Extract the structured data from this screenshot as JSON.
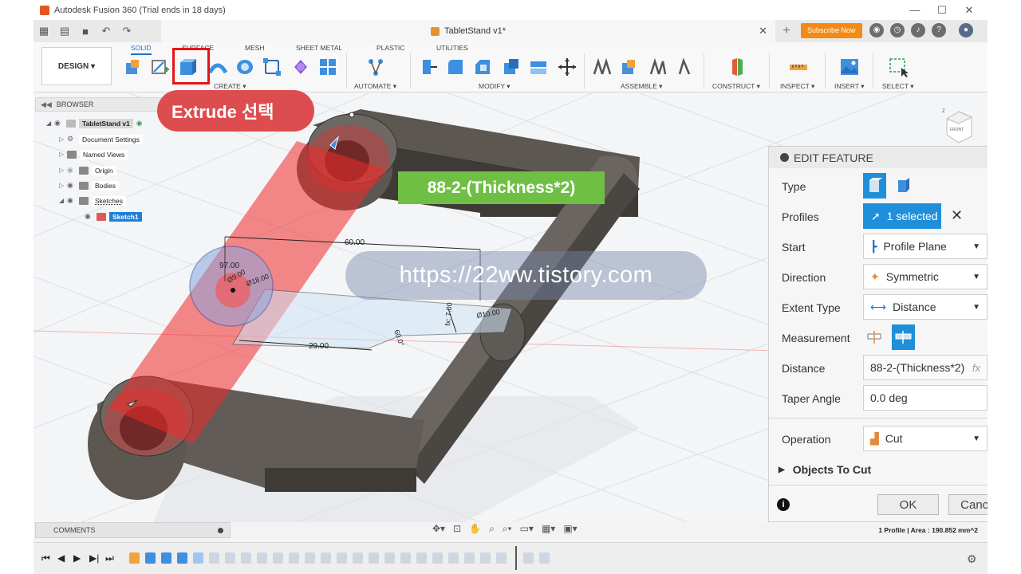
{
  "window": {
    "title": "Autodesk Fusion 360 (Trial ends in 18 days)"
  },
  "document": {
    "tab_title": "TabletStand v1*"
  },
  "header": {
    "subscribe_label": "Subscribe Now"
  },
  "workspace": {
    "label": "DESIGN ▾"
  },
  "ribbon": {
    "tabs": [
      "SOLID",
      "SURFACE",
      "MESH",
      "SHEET METAL",
      "PLASTIC",
      "UTILITIES"
    ],
    "groups": [
      "CREATE ▾",
      "AUTOMATE ▾",
      "MODIFY ▾",
      "ASSEMBLE ▾",
      "CONSTRUCT ▾",
      "INSPECT ▾",
      "INSERT ▾",
      "SELECT ▾"
    ]
  },
  "browser": {
    "title": "BROWSER",
    "items": [
      "TabletStand v1",
      "Document Settings",
      "Named Views",
      "Origin",
      "Bodies",
      "Sketches",
      "Sketch1"
    ]
  },
  "annotations": {
    "callout": "Extrude 선택",
    "formula_note": "88-2-(Thickness*2)",
    "watermark": "https://22ww.tistory.com"
  },
  "sketch_dims": {
    "d1": "60.00",
    "d2": "97.00",
    "d3": "Ø9.00",
    "d4": "Ø18.00",
    "d5": "29.00",
    "d6": "60.0°",
    "d7": "fx: 7.00",
    "d8": "Ø10.00"
  },
  "viewcube": {
    "face": "FRONT",
    "axis": "Z"
  },
  "panel": {
    "title": "EDIT FEATURE",
    "labels": {
      "type": "Type",
      "profiles": "Profiles",
      "start": "Start",
      "direction": "Direction",
      "extent_type": "Extent Type",
      "measurement": "Measurement",
      "distance": "Distance",
      "taper": "Taper Angle",
      "operation": "Operation",
      "objects": "Objects To Cut"
    },
    "values": {
      "profiles": "1 selected",
      "start": "Profile Plane",
      "direction": "Symmetric",
      "extent_type": "Distance",
      "distance": "88-2-(Thickness*2)",
      "distance_fx": "fx",
      "taper": "0.0 deg",
      "operation": "Cut"
    },
    "ok": "OK",
    "cancel": "Cancel"
  },
  "footer": {
    "comments": "COMMENTS",
    "profile_info": "1 Profile | Area : 190.852 mm^2"
  }
}
